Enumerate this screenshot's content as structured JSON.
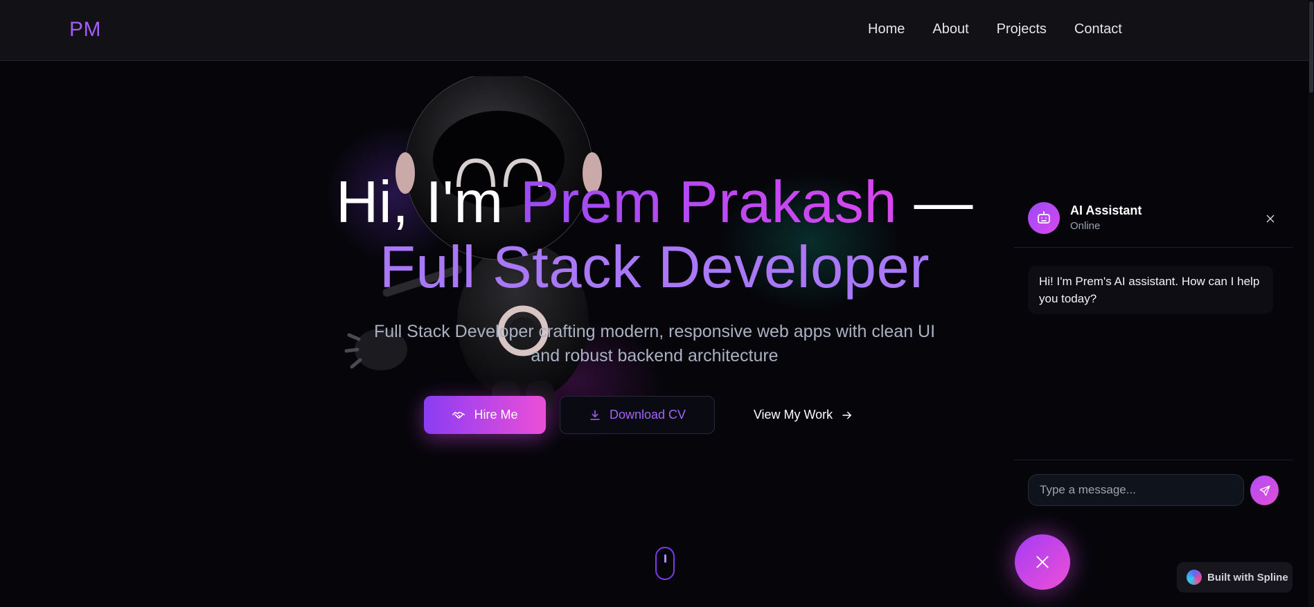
{
  "nav": {
    "logo": "PM",
    "links": [
      "Home",
      "About",
      "Projects",
      "Contact"
    ]
  },
  "hero": {
    "greeting": "Hi, I'm",
    "name": "Prem Prakash",
    "dash": "—",
    "role": "Full Stack Developer",
    "subtitle_line1": "Full Stack Developer crafting modern, responsive web apps with clean UI",
    "subtitle_line2": "and robust backend architecture",
    "buttons": {
      "hire": "Hire Me",
      "download_cv": "Download CV",
      "view_work": "View My Work"
    }
  },
  "chat": {
    "title": "AI Assistant",
    "status": "Online",
    "messages": [
      "Hi! I'm Prem's AI assistant. How can I help you today?"
    ],
    "input_placeholder": "Type a message..."
  },
  "badge": {
    "label": "Built with Spline"
  },
  "colors": {
    "accent_purple": "#9a4cf5",
    "accent_pink": "#d946ef",
    "background": "#06060a",
    "nav_background": "#111116"
  },
  "icons": [
    "handshake-icon",
    "download-icon",
    "arrow-right-icon",
    "robot-icon",
    "close-icon",
    "send-icon",
    "mouse-scroll-icon",
    "spline-logo-icon"
  ]
}
